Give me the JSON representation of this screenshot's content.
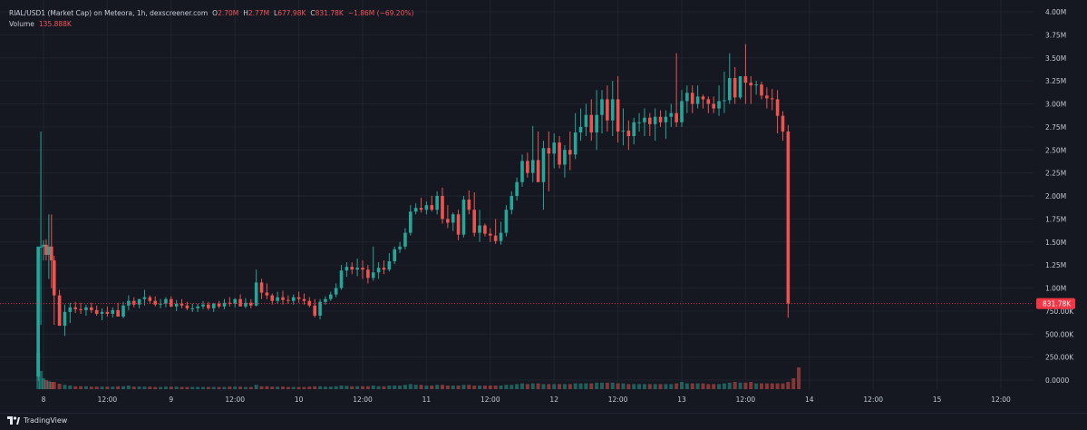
{
  "header": {
    "symbol": "RIAL/USD1 (Market Cap) on Meteora, 1h, dexscreener.com",
    "open_label": "O",
    "open": "2.70M",
    "high_label": "H",
    "high": "2.77M",
    "low_label": "L",
    "low": "677.98K",
    "close_label": "C",
    "close": "831.78K",
    "change": "−1.86M (−69.20%)",
    "volume_label": "Volume",
    "volume": "135.888K"
  },
  "footer": {
    "brand": "TradingView",
    "logo": "tradingview-logo-icon"
  },
  "colors": {
    "background": "#151820",
    "grid": "#1f232d",
    "up": "#26a69a",
    "down": "#ef5350",
    "last_price": "#f23645",
    "text": "#c3c8d3"
  },
  "chart_data": {
    "type": "candlestick",
    "title": "RIAL/USD1 (Market Cap) on Meteora, 1h, dexscreener.com",
    "interval": "1h",
    "y_scale": "linear",
    "ylim": [
      -50000,
      4000000
    ],
    "y_ticks": [
      0,
      250000,
      500000,
      750000,
      1000000,
      1250000,
      1500000,
      1750000,
      2000000,
      2250000,
      2500000,
      2750000,
      3000000,
      3250000,
      3500000,
      3750000,
      4000000
    ],
    "y_tick_labels": [
      "0.0000",
      "250.00K",
      "500.00K",
      "750.00K",
      "1.00M",
      "1.25M",
      "1.50M",
      "1.75M",
      "2.00M",
      "2.25M",
      "2.50M",
      "2.75M",
      "3.00M",
      "3.25M",
      "3.50M",
      "3.75M",
      "4.00M"
    ],
    "x_ticks": [
      0,
      12,
      24,
      36,
      48,
      60,
      72,
      84,
      96,
      108,
      120,
      132,
      144,
      156,
      168,
      180
    ],
    "x_tick_labels": [
      "8",
      "12:00",
      "9",
      "12:00",
      "10",
      "12:00",
      "11",
      "12:00",
      "12",
      "12:00",
      "13",
      "12:00",
      "14",
      "12:00",
      "15",
      "12:00"
    ],
    "x_range_hours": [
      -2,
      183
    ],
    "last_price": 831780,
    "last_price_label": "831.78K",
    "grid": true,
    "series": [
      {
        "name": "Market Cap",
        "kind": "ohlc",
        "hours": [
          -1,
          -0.5,
          0,
          0.5,
          1,
          1.5,
          2,
          3,
          4,
          5,
          6,
          7,
          8,
          9,
          10,
          11,
          12,
          13,
          14,
          15,
          16,
          17,
          18,
          19,
          20,
          21,
          22,
          23,
          24,
          25,
          26,
          27,
          28,
          29,
          30,
          31,
          32,
          33,
          34,
          35,
          36,
          37,
          38,
          39,
          40,
          41,
          42,
          43,
          44,
          45,
          46,
          47,
          48,
          49,
          50,
          51,
          52,
          53,
          54,
          55,
          56,
          57,
          58,
          59,
          60,
          61,
          62,
          63,
          64,
          65,
          66,
          67,
          68,
          69,
          70,
          71,
          72,
          73,
          74,
          75,
          76,
          77,
          78,
          79,
          80,
          81,
          82,
          83,
          84,
          85,
          86,
          87,
          88,
          89,
          90,
          91,
          92,
          93,
          94,
          95,
          96,
          97,
          98,
          99,
          100,
          101,
          102,
          103,
          104,
          105,
          106,
          107,
          108,
          109,
          110,
          111,
          112,
          113,
          114,
          115,
          116,
          117,
          118,
          119,
          120,
          121,
          122,
          123,
          124,
          125,
          126,
          127,
          128,
          129,
          130,
          131,
          132,
          133,
          134,
          135,
          136,
          137,
          138,
          139,
          140,
          141,
          142,
          143,
          144,
          145,
          146,
          147,
          148
        ],
        "open": [
          40000,
          1450000,
          1450000,
          1470000,
          1360000,
          1450000,
          1300000,
          920000,
          590000,
          740000,
          790000,
          770000,
          760000,
          790000,
          760000,
          720000,
          740000,
          720000,
          760000,
          690000,
          810000,
          860000,
          820000,
          880000,
          900000,
          860000,
          820000,
          830000,
          880000,
          800000,
          830000,
          810000,
          780000,
          780000,
          800000,
          820000,
          780000,
          830000,
          800000,
          840000,
          830000,
          880000,
          800000,
          840000,
          810000,
          1060000,
          950000,
          920000,
          860000,
          900000,
          870000,
          860000,
          900000,
          880000,
          860000,
          810000,
          700000,
          850000,
          880000,
          930000,
          1000000,
          1190000,
          1230000,
          1200000,
          1220000,
          1200000,
          1110000,
          1170000,
          1220000,
          1200000,
          1290000,
          1420000,
          1450000,
          1600000,
          1830000,
          1870000,
          1850000,
          1900000,
          1850000,
          2000000,
          1750000,
          1710000,
          1800000,
          1580000,
          1960000,
          1850000,
          1600000,
          1680000,
          1590000,
          1570000,
          1510000,
          1600000,
          1850000,
          2000000,
          2150000,
          2380000,
          2250000,
          2390000,
          2150000,
          2520000,
          2460000,
          2580000,
          2340000,
          2500000,
          2450000,
          2690000,
          2750000,
          2880000,
          2690000,
          2880000,
          3050000,
          2820000,
          3050000,
          2700000,
          2710000,
          2650000,
          2800000,
          2800000,
          2850000,
          2780000,
          2860000,
          2800000,
          2860000,
          2900000,
          2800000,
          3030000,
          3120000,
          3000000,
          3080000,
          3050000,
          3000000,
          2950000,
          3030000,
          3040000,
          3280000,
          3070000,
          3300000,
          3230000,
          3200000,
          3210000,
          3090000,
          3060000,
          3050000,
          2870000,
          2700000
        ],
        "high": [
          1000000,
          2700000,
          1520000,
          1530000,
          1800000,
          1800000,
          1350000,
          980000,
          820000,
          840000,
          850000,
          840000,
          820000,
          840000,
          810000,
          780000,
          800000,
          790000,
          840000,
          850000,
          920000,
          900000,
          880000,
          980000,
          920000,
          910000,
          880000,
          900000,
          910000,
          870000,
          880000,
          850000,
          830000,
          830000,
          860000,
          850000,
          840000,
          860000,
          880000,
          900000,
          890000,
          930000,
          890000,
          880000,
          1200000,
          1100000,
          1050000,
          940000,
          960000,
          970000,
          920000,
          930000,
          960000,
          940000,
          900000,
          880000,
          880000,
          910000,
          960000,
          1050000,
          1250000,
          1280000,
          1280000,
          1320000,
          1300000,
          1250000,
          1450000,
          1280000,
          1300000,
          1380000,
          1450000,
          1500000,
          1650000,
          1900000,
          1920000,
          1980000,
          1940000,
          2000000,
          2050000,
          2090000,
          1900000,
          1820000,
          1850000,
          2000000,
          2060000,
          2040000,
          1850000,
          1700000,
          1650000,
          1750000,
          1720000,
          1900000,
          2050000,
          2200000,
          2450000,
          2470000,
          2760000,
          2700000,
          2600000,
          2700000,
          2680000,
          2650000,
          2550000,
          2700000,
          2900000,
          2950000,
          3000000,
          3050000,
          3150000,
          3150000,
          3200000,
          3250000,
          3300000,
          2950000,
          2820000,
          2850000,
          2900000,
          2950000,
          2900000,
          2950000,
          2930000,
          2930000,
          3000000,
          3550000,
          3150000,
          3200000,
          3200000,
          3200000,
          3100000,
          3080000,
          3080000,
          3200000,
          3350000,
          3550000,
          3400000,
          3300000,
          3650000,
          3300000,
          3250000,
          3240000,
          3180000,
          3160000,
          3150000,
          2920000,
          2770000
        ],
        "low": [
          -10000,
          600000,
          1300000,
          1300000,
          1100000,
          1000000,
          600000,
          600000,
          480000,
          620000,
          730000,
          720000,
          700000,
          730000,
          700000,
          650000,
          690000,
          680000,
          720000,
          670000,
          760000,
          790000,
          780000,
          810000,
          830000,
          800000,
          780000,
          790000,
          790000,
          750000,
          780000,
          760000,
          740000,
          740000,
          770000,
          760000,
          740000,
          780000,
          770000,
          800000,
          790000,
          810000,
          780000,
          780000,
          800000,
          880000,
          880000,
          820000,
          830000,
          820000,
          830000,
          820000,
          840000,
          820000,
          790000,
          680000,
          660000,
          820000,
          860000,
          900000,
          980000,
          1120000,
          1150000,
          1130000,
          1100000,
          1050000,
          1080000,
          1100000,
          1150000,
          1180000,
          1260000,
          1380000,
          1420000,
          1570000,
          1800000,
          1820000,
          1800000,
          1830000,
          1800000,
          1700000,
          1650000,
          1620000,
          1520000,
          1550000,
          1800000,
          1560000,
          1500000,
          1560000,
          1500000,
          1480000,
          1470000,
          1560000,
          1800000,
          1950000,
          2100000,
          2200000,
          2150000,
          2250000,
          1850000,
          2050000,
          2300000,
          2300000,
          2200000,
          2280000,
          2400000,
          2600000,
          2650000,
          2600000,
          2500000,
          2680000,
          2700000,
          2650000,
          2580000,
          2550000,
          2500000,
          2560000,
          2700000,
          2650000,
          2650000,
          2600000,
          2750000,
          2620000,
          2750000,
          2750000,
          2750000,
          2900000,
          2900000,
          2950000,
          2950000,
          2900000,
          2900000,
          2870000,
          2900000,
          3000000,
          3000000,
          3050000,
          3000000,
          3000000,
          3100000,
          3050000,
          2950000,
          2930000,
          2680000,
          2600000,
          677980
        ],
        "close": [
          1450000,
          1450000,
          1470000,
          1360000,
          1450000,
          1300000,
          920000,
          590000,
          740000,
          790000,
          770000,
          760000,
          790000,
          760000,
          720000,
          740000,
          720000,
          760000,
          690000,
          810000,
          860000,
          820000,
          880000,
          900000,
          860000,
          820000,
          830000,
          880000,
          800000,
          830000,
          810000,
          780000,
          780000,
          800000,
          820000,
          780000,
          830000,
          800000,
          840000,
          830000,
          880000,
          800000,
          840000,
          810000,
          1060000,
          950000,
          920000,
          860000,
          900000,
          870000,
          860000,
          900000,
          880000,
          860000,
          810000,
          700000,
          850000,
          880000,
          930000,
          1000000,
          1190000,
          1230000,
          1200000,
          1220000,
          1200000,
          1110000,
          1170000,
          1220000,
          1200000,
          1290000,
          1420000,
          1450000,
          1600000,
          1830000,
          1870000,
          1850000,
          1900000,
          1850000,
          2000000,
          1750000,
          1710000,
          1800000,
          1580000,
          1960000,
          1850000,
          1600000,
          1680000,
          1590000,
          1570000,
          1510000,
          1600000,
          1850000,
          2000000,
          2150000,
          2380000,
          2250000,
          2390000,
          2150000,
          2520000,
          2460000,
          2580000,
          2340000,
          2500000,
          2450000,
          2690000,
          2750000,
          2880000,
          2690000,
          2880000,
          3050000,
          2820000,
          3050000,
          2700000,
          2710000,
          2650000,
          2800000,
          2800000,
          2850000,
          2780000,
          2860000,
          2800000,
          2860000,
          2900000,
          2800000,
          3030000,
          3120000,
          3000000,
          3080000,
          3050000,
          3000000,
          2950000,
          3030000,
          3040000,
          3280000,
          3070000,
          3300000,
          3230000,
          3200000,
          3210000,
          3090000,
          3060000,
          3050000,
          2870000,
          2700000,
          831780
        ]
      },
      {
        "name": "Volume",
        "kind": "volume",
        "hours": [
          -1,
          -0.5,
          0,
          0.5,
          1,
          1.5,
          2,
          3,
          4,
          5,
          6,
          7,
          8,
          9,
          10,
          11,
          12,
          13,
          14,
          15,
          16,
          17,
          18,
          19,
          20,
          21,
          22,
          23,
          24,
          25,
          26,
          27,
          28,
          29,
          30,
          31,
          32,
          33,
          34,
          35,
          36,
          37,
          38,
          39,
          40,
          41,
          42,
          43,
          44,
          45,
          46,
          47,
          48,
          49,
          50,
          51,
          52,
          53,
          54,
          55,
          56,
          57,
          58,
          59,
          60,
          61,
          62,
          63,
          64,
          65,
          66,
          67,
          68,
          69,
          70,
          71,
          72,
          73,
          74,
          75,
          76,
          77,
          78,
          79,
          80,
          81,
          82,
          83,
          84,
          85,
          86,
          87,
          88,
          89,
          90,
          91,
          92,
          93,
          94,
          95,
          96,
          97,
          98,
          99,
          100,
          101,
          102,
          103,
          104,
          105,
          106,
          107,
          108,
          109,
          110,
          111,
          112,
          113,
          114,
          115,
          116,
          117,
          118,
          119,
          120,
          121,
          122,
          123,
          124,
          125,
          126,
          127,
          128,
          129,
          130,
          131,
          132,
          133,
          134,
          135,
          136,
          137,
          138,
          139,
          140,
          141,
          142,
          143,
          144,
          145,
          146,
          147,
          148
        ],
        "values": [
          1.0,
          0.5,
          0.3,
          0.25,
          0.22,
          0.2,
          0.2,
          0.15,
          0.12,
          0.1,
          0.08,
          0.08,
          0.08,
          0.07,
          0.07,
          0.07,
          0.07,
          0.07,
          0.08,
          0.08,
          0.1,
          0.07,
          0.07,
          0.07,
          0.07,
          0.06,
          0.06,
          0.07,
          0.07,
          0.07,
          0.06,
          0.06,
          0.06,
          0.06,
          0.06,
          0.06,
          0.06,
          0.06,
          0.06,
          0.07,
          0.07,
          0.07,
          0.06,
          0.06,
          0.12,
          0.08,
          0.08,
          0.07,
          0.07,
          0.07,
          0.06,
          0.06,
          0.06,
          0.06,
          0.07,
          0.08,
          0.08,
          0.07,
          0.07,
          0.08,
          0.1,
          0.09,
          0.08,
          0.08,
          0.08,
          0.08,
          0.1,
          0.08,
          0.08,
          0.1,
          0.1,
          0.1,
          0.12,
          0.14,
          0.12,
          0.12,
          0.1,
          0.1,
          0.12,
          0.12,
          0.1,
          0.1,
          0.1,
          0.12,
          0.12,
          0.1,
          0.1,
          0.1,
          0.1,
          0.1,
          0.1,
          0.12,
          0.12,
          0.14,
          0.16,
          0.14,
          0.16,
          0.16,
          0.14,
          0.14,
          0.14,
          0.14,
          0.14,
          0.14,
          0.16,
          0.16,
          0.16,
          0.16,
          0.18,
          0.18,
          0.18,
          0.18,
          0.16,
          0.16,
          0.14,
          0.14,
          0.14,
          0.14,
          0.14,
          0.14,
          0.14,
          0.14,
          0.14,
          0.16,
          0.2,
          0.16,
          0.16,
          0.16,
          0.16,
          0.14,
          0.14,
          0.14,
          0.16,
          0.18,
          0.2,
          0.18,
          0.18,
          0.2,
          0.16,
          0.16,
          0.16,
          0.16,
          0.16,
          0.16,
          0.2,
          0.3,
          0.6
        ],
        "value_scale": "relative (0-1)"
      }
    ]
  }
}
